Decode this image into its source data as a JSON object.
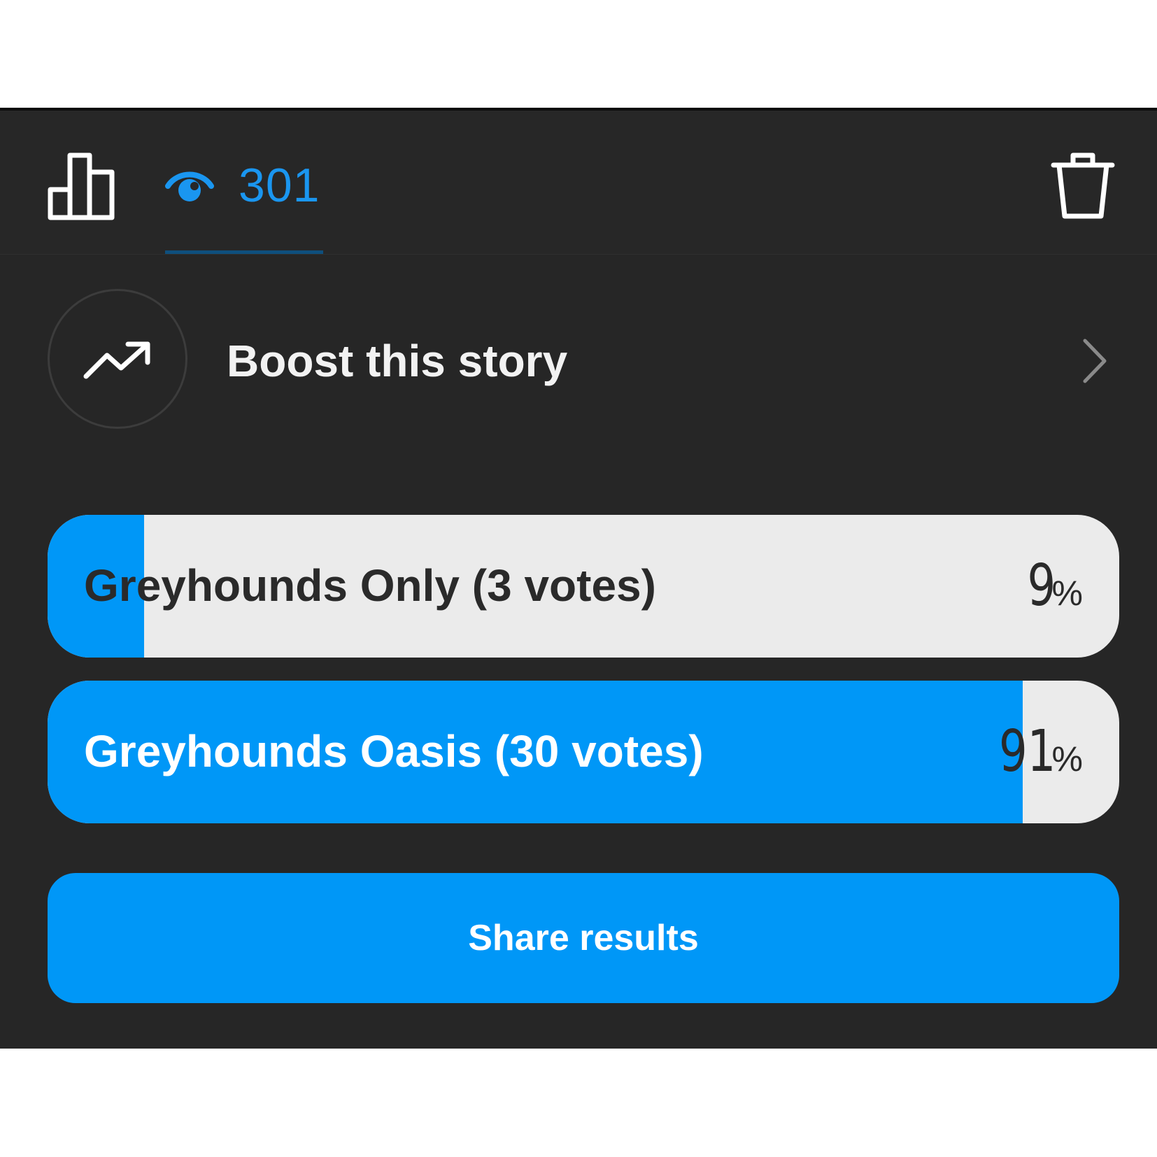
{
  "header": {
    "viewer_count": "301",
    "accent_color": "#1a96f0",
    "icons": [
      "bar-chart-icon",
      "eye-icon",
      "trash-icon"
    ]
  },
  "boost": {
    "label": "Boost this story",
    "icons": [
      "trend-up-icon",
      "chevron-right-icon"
    ]
  },
  "poll": {
    "options": [
      {
        "label": "Greyhounds Only (3 votes)",
        "percent_value": "9",
        "percent_symbol": "%",
        "fill_fraction": 0.09
      },
      {
        "label": "Greyhounds Oasis (30 votes)",
        "percent_value": "91",
        "percent_symbol": "%",
        "fill_fraction": 0.91
      }
    ],
    "fill_color": "#0097f7",
    "track_color": "#ebebeb"
  },
  "share": {
    "label": "Share results"
  }
}
